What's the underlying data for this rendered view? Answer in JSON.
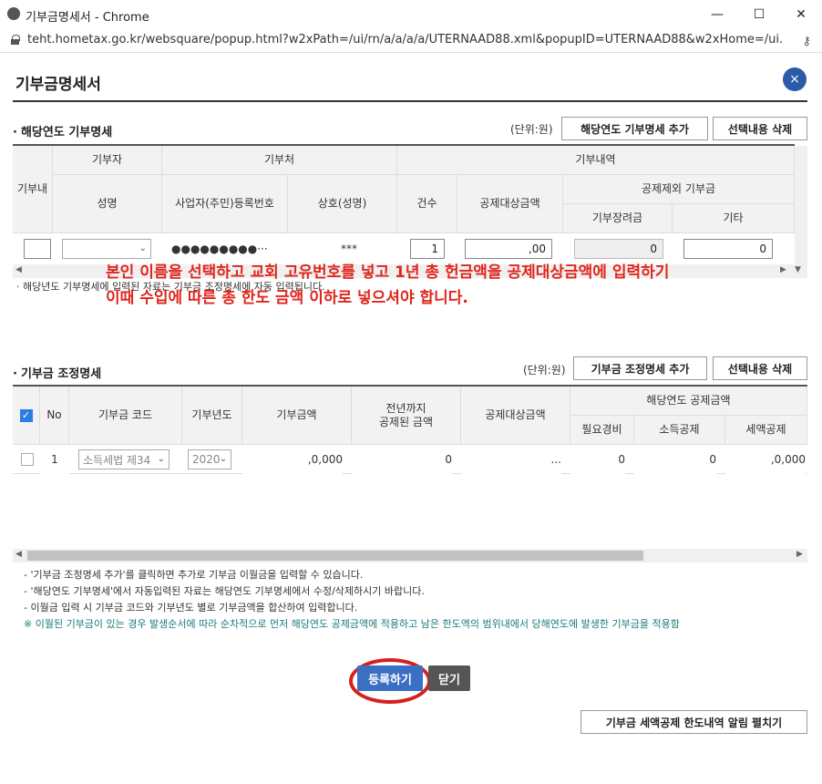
{
  "window": {
    "title": "기부금명세서 - Chrome",
    "url": "teht.hometax.go.kr/websquare/popup.html?w2xPath=/ui/rn/a/a/a/a/UTERNAAD88.xml&popupID=UTERNAAD88&w2xHome=/ui..."
  },
  "popup": {
    "title": "기부금명세서",
    "close_icon": "×"
  },
  "section1": {
    "title": "해당연도 기부명세",
    "unit": "(단위:원)",
    "add_button": "해당연도 기부명세 추가",
    "delete_button": "선택내용 삭제",
    "headers": {
      "donation_type": "기부내",
      "donor": "기부자",
      "recipient": "기부처",
      "details": "기부내역",
      "name": "성명",
      "regno": "사업자(주민)등록번호",
      "company": "상호(성명)",
      "count": "건수",
      "deductible": "공제대상금액",
      "excluded": "공제제외 기부금",
      "encouragement": "기부장려금",
      "other": "기타"
    },
    "row": {
      "regno": "●●●●●●●●●···",
      "company": "***",
      "count": "1",
      "deductible": ",00",
      "encouragement": "0",
      "other": "0"
    }
  },
  "annotation": {
    "line1": "본인 이름을 선택하고 교회 고유번호를 넣고 1년 총 헌금액을 공제대상금액에 입력하기",
    "line2": "이때 수입에 따른 총 한도 금액 이하로 넣으셔야 합니다."
  },
  "section1_note": "· 해당년도 기부명세에 입력된 자료는 기부금 조정명세에 자동 입력됩니다.",
  "section2": {
    "title": "기부금 조정명세",
    "unit": "(단위:원)",
    "add_button": "기부금 조정명세 추가",
    "delete_button": "선택내용 삭제",
    "headers": {
      "no": "No",
      "code": "기부금 코드",
      "year": "기부년도",
      "amount": "기부금액",
      "prev_deducted": "전년까지\n공제된 금액",
      "deductible": "공제대상금액",
      "current": "해당연도 공제금액",
      "expenses": "필요경비",
      "income_ded": "소득공제",
      "tax_credit": "세액공제"
    },
    "row": {
      "no": "1",
      "code": "소득세법 제34",
      "year": "2020",
      "amount": ",0,000",
      "prev_deducted": "0",
      "deductible": "...",
      "expenses": "0",
      "income_ded": "0",
      "tax_credit": ",0,000"
    }
  },
  "notes": [
    "- '기부금 조정명세 추가'를 클릭하면 추가로 기부금 이월금을 입력할 수 있습니다.",
    "- '해당연도 기부명세'에서 자동입력된 자료는 해당연도 기부명세에서 수정/삭제하시기 바랍니다.",
    "- 이월금 입력 시 기부금 코드와 기부년도 별로 기부금액을 합산하여 입력합니다."
  ],
  "notice": "※ 이월된 기부금이 있는 경우 발생순서에 따라 순차적으로 먼저 해당연도 공제금액에 적용하고 남은 한도액의 범위내에서 당해연도에 발생한 기부금을 적용함",
  "buttons": {
    "register": "등록하기",
    "close": "닫기",
    "limit_info": "기부금 세액공제 한도내역 알림 펼치기"
  },
  "colors": {
    "accent": "#3b6fc4",
    "annotation": "#e0261c",
    "close": "#2b5aa8"
  }
}
